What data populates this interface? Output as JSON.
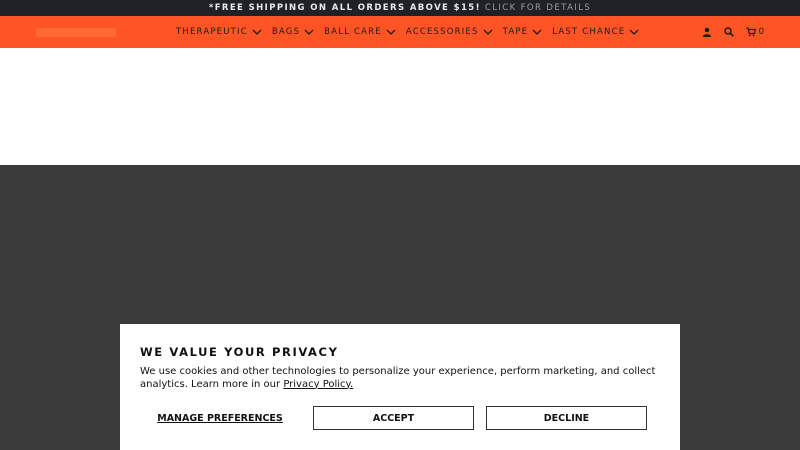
{
  "announcement": {
    "text": "*FREE SHIPPING ON ALL ORDERS ABOVE $15!",
    "link": "CLICK FOR DETAILS"
  },
  "nav": {
    "items": [
      {
        "label": "THERAPEUTIC"
      },
      {
        "label": "BAGS"
      },
      {
        "label": "BALL CARE"
      },
      {
        "label": "ACCESSORIES"
      },
      {
        "label": "TAPE"
      },
      {
        "label": "LAST CHANCE"
      }
    ]
  },
  "header_utils": {
    "cart_count": "0",
    "icons": [
      "account-icon",
      "search-icon",
      "cart-icon"
    ]
  },
  "privacy": {
    "title": "WE VALUE YOUR PRIVACY",
    "body_text": "We use cookies and other technologies to personalize your experience, perform marketing, and collect analytics. Learn more in our ",
    "policy_link": "Privacy Policy.",
    "manage_label": "MANAGE PREFERENCES",
    "accept_label": "ACCEPT",
    "decline_label": "DECLINE"
  },
  "colors": {
    "announcement_bg": "#1f2127",
    "header_bg": "#ff5423",
    "dark_band": "#3b3b3b"
  }
}
